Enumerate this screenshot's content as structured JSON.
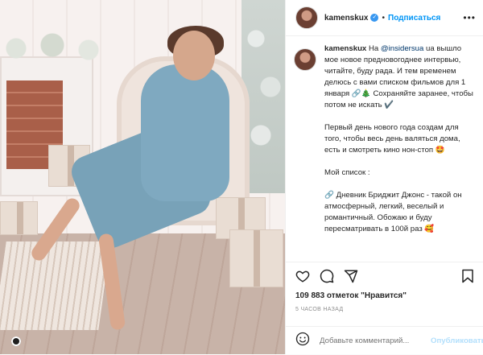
{
  "post": {
    "username": "kamenskux",
    "verified_mark": "✓",
    "separator": "•",
    "follow_label": "Подписаться",
    "more_label": "•••"
  },
  "caption": {
    "username": "kamenskux",
    "p1_before": "На ",
    "p1_mention": "@insidersua",
    "p1_after": " ua вышло мое новое предновогоднее интервью, читайте, буду рада. И тем временем делюсь с вами списком фильмов для 1 января 🔗🎄 Сохраняйте заранее, чтобы потом не искать ✔️",
    "p2": "Первый день нового года создам для того, чтобы весь день валяться дома, есть и смотреть кино нон-стоп 🤩",
    "p3": "Мой список :",
    "p4": "🔗 Дневник Бриджит Джонс - такой он атмосферный, легкий, веселый и романтичный. Обожаю и буду пересматривать в 100й раз 🥰"
  },
  "actions": {
    "like_icon": "heart-icon",
    "comment_icon": "comment-icon",
    "share_icon": "share-icon",
    "save_icon": "bookmark-icon"
  },
  "likes_text": "109 883 отметок \"Нравится\"",
  "time_text": "5 ЧАСОВ НАЗАД",
  "comment": {
    "placeholder": "Добавьте комментарий...",
    "publish_label": "Опубликовать"
  },
  "colors": {
    "accent": "#0095f6",
    "publish_disabled": "#b2dffc",
    "text": "#262626",
    "muted": "#8e8e8e"
  }
}
